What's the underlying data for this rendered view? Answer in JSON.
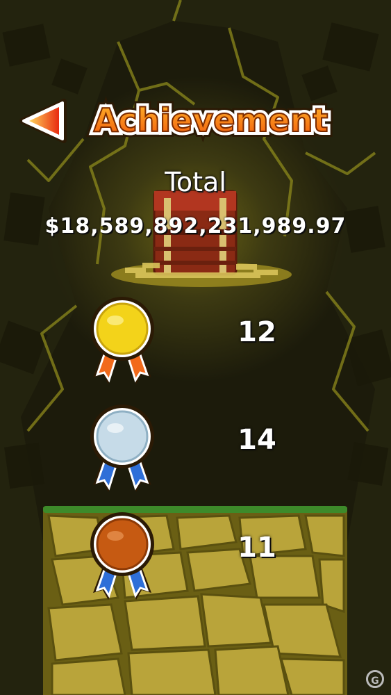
{
  "screen": {
    "title": "Achievement",
    "back_icon": "left-arrow-icon"
  },
  "total": {
    "label": "Total",
    "value": "$18,589,892,231,989.97"
  },
  "medals": [
    {
      "type": "gold",
      "icon": "gold-medal-icon",
      "count": "12",
      "color": "#f3d31a",
      "ribbon": "#f26a1b"
    },
    {
      "type": "silver",
      "icon": "silver-medal-icon",
      "count": "14",
      "color": "#c6dbe8",
      "ribbon": "#2f6fd8"
    },
    {
      "type": "bronze",
      "icon": "bronze-medal-icon",
      "count": "11",
      "color": "#c65a12",
      "ribbon": "#2f6fd8"
    }
  ],
  "colors": {
    "title_orange": "#f25a0c",
    "ground_grass": "#3d8a2a",
    "ground_stone": "#b9a43a"
  }
}
